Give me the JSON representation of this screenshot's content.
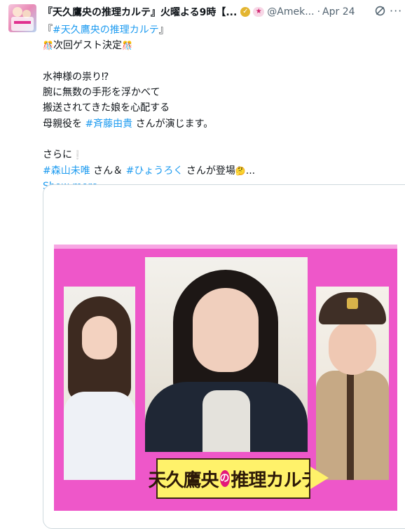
{
  "tweet": {
    "display_name": "『天久鷹央の推理カルテ』火曜よる9時【...",
    "handle": "@Amek...",
    "separator": "·",
    "date": "Apr 24",
    "more_label": "···",
    "lines": [
      {
        "prefix": "『",
        "tag": "#天久鷹央の推理カルテ",
        "suffix": "』"
      },
      {
        "emoji_left": "🎊",
        "text": "次回ゲスト決定",
        "emoji_right": "🎊"
      },
      {
        "text": ""
      },
      {
        "text": "水神様の祟り⁉"
      },
      {
        "text": "腕に無数の手形を浮かべて"
      },
      {
        "text": "搬送されてきた娘を心配する"
      },
      {
        "prefix": "母親役を ",
        "tag": "#斉藤由貴",
        "suffix": " さんが演じます。"
      },
      {
        "text": ""
      },
      {
        "text": "さらに",
        "emoji_right": "❕"
      },
      {
        "tag": "#森山未唯",
        "suffix": " さん＆ ",
        "tag2": "#ひょうろく",
        "suffix2": " さんが登場",
        "emoji": "🤔",
        "ellipsis": "..."
      }
    ],
    "show_more": "Show more"
  },
  "card": {
    "title_part1": "天久鷹央",
    "title_no": "の",
    "title_part2": "推理カルテ"
  },
  "colors": {
    "link": "#1d9bf0",
    "promo_background": "#ee57c9",
    "title_plate": "#fff26a"
  },
  "icons": {
    "verified": "gold-verified-badge",
    "affiliate": "pink-affiliate-badge",
    "grok": "grok-icon"
  }
}
